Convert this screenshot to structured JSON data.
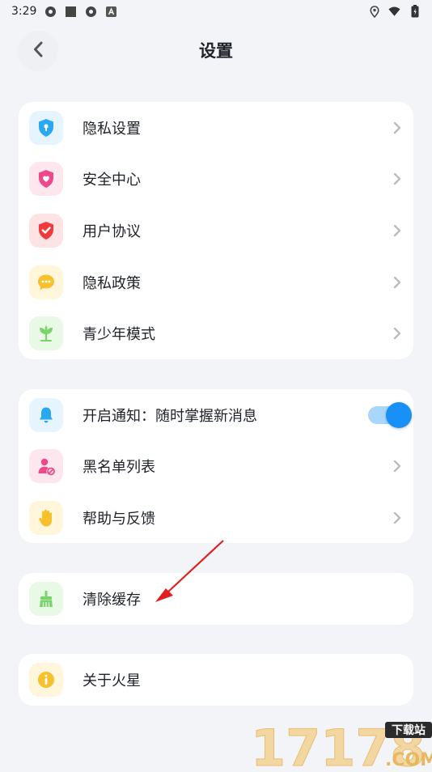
{
  "status_bar": {
    "time": "3:29"
  },
  "header": {
    "title": "设置"
  },
  "groups": [
    {
      "items": [
        {
          "label": "隐私设置",
          "icon": "shield-lock-icon",
          "tint": "#e6f4fd",
          "color": "#2aa8f2"
        },
        {
          "label": "安全中心",
          "icon": "heart-shield-icon",
          "tint": "#fde6ee",
          "color": "#f0478a"
        },
        {
          "label": "用户协议",
          "icon": "check-shield-icon",
          "tint": "#fde3e3",
          "color": "#ef3b3b"
        },
        {
          "label": "隐私政策",
          "icon": "chat-bubble-icon",
          "tint": "#fff6dc",
          "color": "#f6c12c"
        },
        {
          "label": "青少年模式",
          "icon": "sprout-icon",
          "tint": "#e8f9e6",
          "color": "#7bd36b"
        }
      ]
    },
    {
      "items": [
        {
          "label": "开启通知：随时掌握新消息",
          "icon": "bell-icon",
          "tint": "#e6f4fd",
          "color": "#2aa8f2",
          "toggle": true
        },
        {
          "label": "黑名单列表",
          "icon": "blocked-user-icon",
          "tint": "#fde6ee",
          "color": "#f0478a"
        },
        {
          "label": "帮助与反馈",
          "icon": "hand-icon",
          "tint": "#fff6dc",
          "color": "#f6c12c"
        }
      ]
    },
    {
      "items": [
        {
          "label": "清除缓存",
          "icon": "broom-icon",
          "tint": "#e8f9e6",
          "color": "#7bd36b"
        }
      ]
    },
    {
      "items": [
        {
          "label": "关于火星",
          "icon": "info-icon",
          "tint": "#fff6dc",
          "color": "#f6c12c"
        }
      ]
    }
  ],
  "watermark": {
    "top_text": "下载站",
    "number": "17178",
    "domain": ".COM"
  }
}
